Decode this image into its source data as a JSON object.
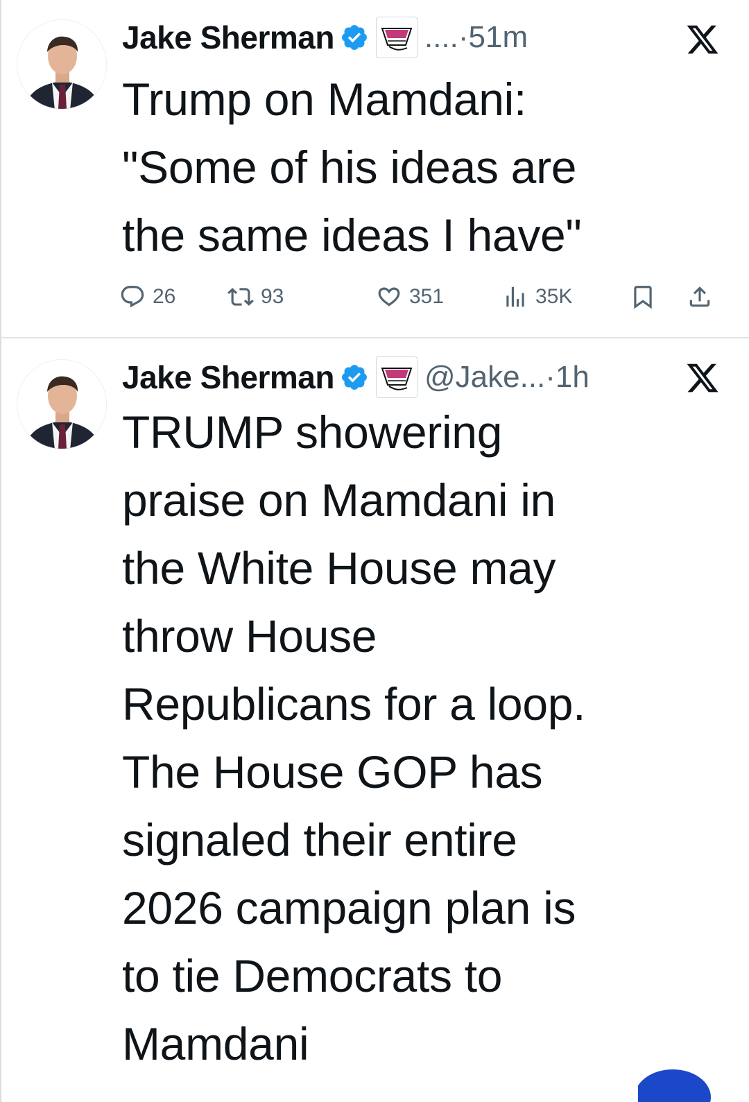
{
  "tweets": [
    {
      "author": {
        "name": "Jake Sherman"
      },
      "meta": "....·51m",
      "text_lines": [
        "Trump on Mamdani:",
        "\"Some of his ideas are",
        "the same ideas I have\""
      ],
      "stats": {
        "replies": "26",
        "reposts": "93",
        "likes": "351",
        "views": "35K"
      }
    },
    {
      "author": {
        "name": "Jake Sherman"
      },
      "meta": "@Jake...·1h",
      "text_lines": [
        "TRUMP showering",
        "praise on Mamdani in",
        "the White House may",
        "throw House",
        "Republicans for a loop.",
        "The House GOP has",
        "signaled their entire",
        "2026 campaign plan is",
        "to tie Democrats to",
        "Mamdani"
      ]
    }
  ],
  "colors": {
    "verified": "#1d9bf0",
    "muted": "#536471",
    "text": "#0f1419"
  },
  "icons": [
    "reply-icon",
    "repost-icon",
    "like-icon",
    "views-icon",
    "bookmark-icon",
    "share-icon",
    "x-logo-icon",
    "verified-badge-icon"
  ]
}
